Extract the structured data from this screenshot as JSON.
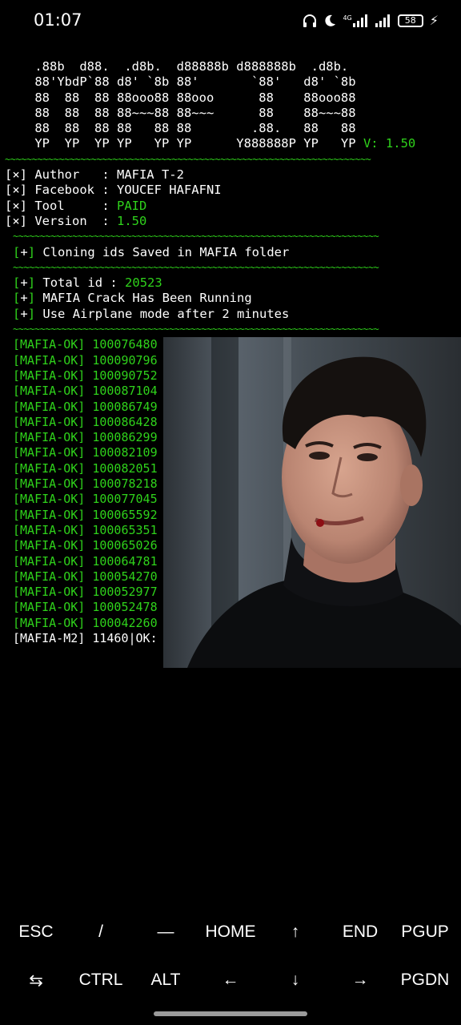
{
  "status_bar": {
    "time": "01:07",
    "network": "4G",
    "battery": "58"
  },
  "terminal": {
    "banner_lines": [
      " .88b  d88.  .d8b.  d88888b d888888b  .d8b. ",
      " 88'YbdP`88 d8' `8b 88'       `88'   d8' `8b",
      " 88  88  88 88ooo88 88ooo      88    88ooo88",
      " 88  88  88 88~~~88 88~~~      88    88~~~88",
      " 88  88  88 88   88 88        .88.   88   88",
      " YP  YP  YP YP   YP YP      Y888888P YP   YP "
    ],
    "version_tag": "V: 1.50",
    "separator": "~~~~~~~~~~~~~~~~~~~~~~~~~~~~~~~~~~~~~~~~~~~~~~~~~~~~~~~~~~~~~~~~~~~~",
    "info": [
      {
        "key": "[×] Author   : ",
        "value": "MAFIA T-2",
        "value_color": "white"
      },
      {
        "key": "[×] Facebook : ",
        "value": "YOUCEF HAFAFNI",
        "value_color": "white"
      },
      {
        "key": "[×] Tool     : ",
        "value": "PAID",
        "value_color": "green"
      },
      {
        "key": "[×] Version  : ",
        "value": "1.50",
        "value_color": "green"
      }
    ],
    "saved_msg": "Cloning ids Saved in MAFIA folder",
    "total_label": "Total id : ",
    "total_value": "20523",
    "running_msg": "MAFIA Crack Has Been Running",
    "airplane_msg": "Use Airplane mode after 2 minutes",
    "plus_open": "[",
    "plus_sign": "+",
    "plus_close": "]",
    "cloned": [
      "[MAFIA-OK] 100076480",
      "[MAFIA-OK] 100090796",
      "[MAFIA-OK] 100090752",
      "[MAFIA-OK] 100087104",
      "[MAFIA-OK] 100086749",
      "[MAFIA-OK] 100086428",
      "[MAFIA-OK] 100086299",
      "[MAFIA-OK] 100082109",
      "[MAFIA-OK] 100082051",
      "[MAFIA-OK] 100078218",
      "[MAFIA-OK] 100077045",
      "[MAFIA-OK] 100065592",
      "[MAFIA-OK] 100065351",
      "[MAFIA-OK] 100065026",
      "[MAFIA-OK] 100064781",
      "[MAFIA-OK] 100054270",
      "[MAFIA-OK] 100052977",
      "[MAFIA-OK] 100052478",
      "[MAFIA-OK] 100042260"
    ],
    "progress": "[MAFIA-M2] 11460|OK:"
  },
  "extra_keys": {
    "row1": [
      "ESC",
      "/",
      "—",
      "HOME",
      "↑",
      "END",
      "PGUP"
    ],
    "row2": [
      "⇆",
      "CTRL",
      "ALT",
      "←",
      "↓",
      "→",
      "PGDN"
    ]
  },
  "colors": {
    "terminal_green": "#2fd21b",
    "background": "#000000",
    "text": "#ffffff"
  }
}
